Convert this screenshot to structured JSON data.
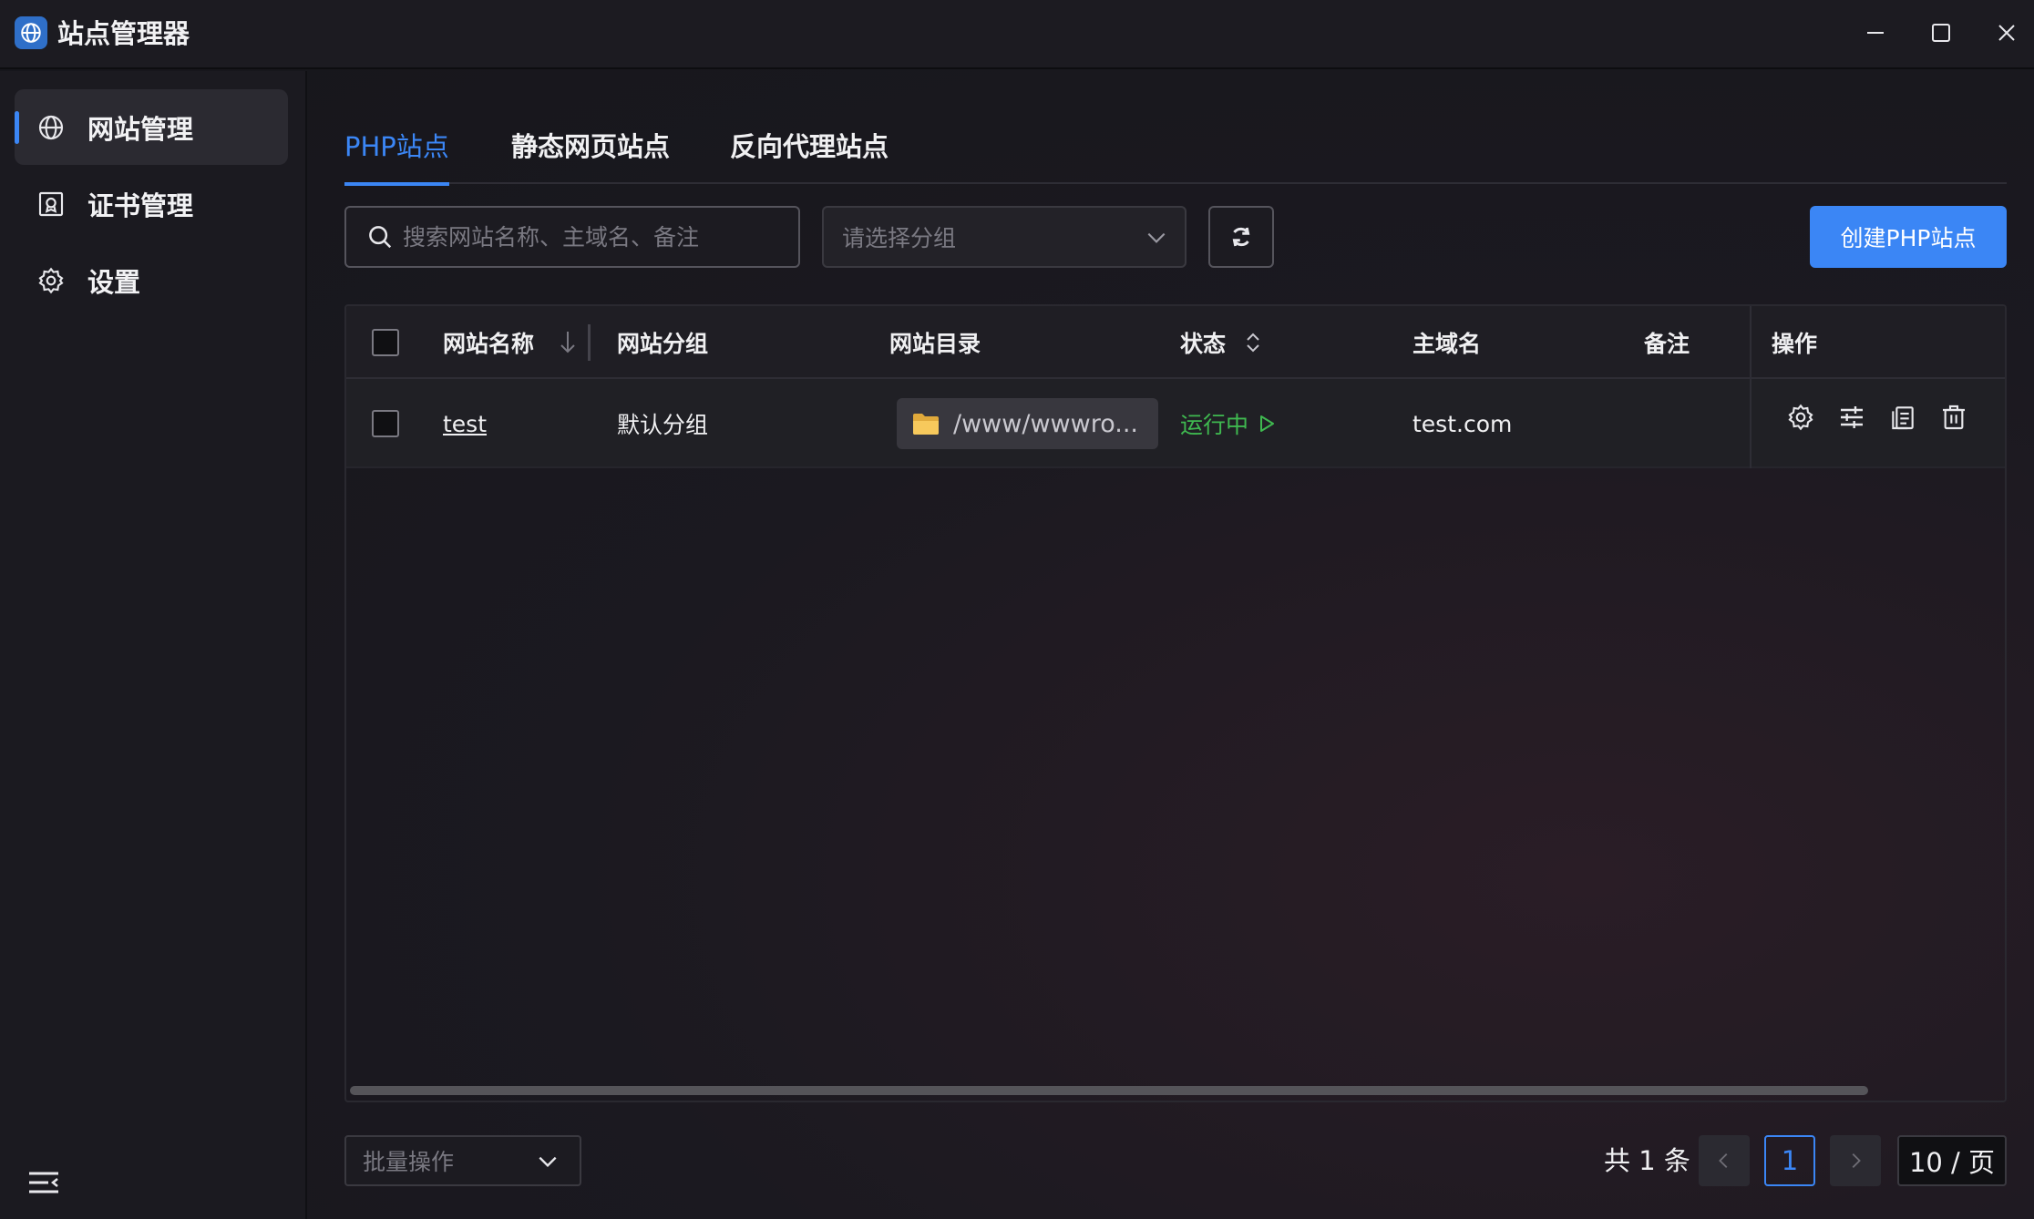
{
  "app": {
    "title": "站点管理器",
    "icon": "globe-icon",
    "accent": "#3b86f5"
  },
  "window_controls": [
    "minimize-icon",
    "maximize-icon",
    "close-icon"
  ],
  "sidebar": {
    "items": [
      {
        "label": "网站管理",
        "icon": "globe-icon",
        "active": true
      },
      {
        "label": "证书管理",
        "icon": "certificate-icon",
        "active": false
      },
      {
        "label": "设置",
        "icon": "gear-icon",
        "active": false
      }
    ],
    "collapse_icon": "menu-collapse-icon"
  },
  "tabs": [
    {
      "label": "PHP站点",
      "active": true
    },
    {
      "label": "静态网页站点",
      "active": false
    },
    {
      "label": "反向代理站点",
      "active": false
    }
  ],
  "toolbar": {
    "search_placeholder": "搜索网站名称、主域名、备注",
    "group_placeholder": "请选择分组",
    "refresh_icon": "refresh-icon",
    "create_label": "创建PHP站点"
  },
  "table": {
    "columns": [
      "网站名称",
      "网站分组",
      "网站目录",
      "状态",
      "主域名",
      "备注",
      "操作"
    ],
    "rows": [
      {
        "name": "test",
        "group": "默认分组",
        "directory": "/www/wwwro...",
        "status": "运行中",
        "status_color": "#3fb950",
        "domain": "test.com",
        "remark": "",
        "actions": [
          "gear-icon",
          "sliders-icon",
          "copy-icon",
          "trash-icon"
        ]
      }
    ]
  },
  "footer": {
    "batch_placeholder": "批量操作",
    "total": "共 1 条",
    "current_page": "1",
    "page_size": "10 / 页"
  }
}
